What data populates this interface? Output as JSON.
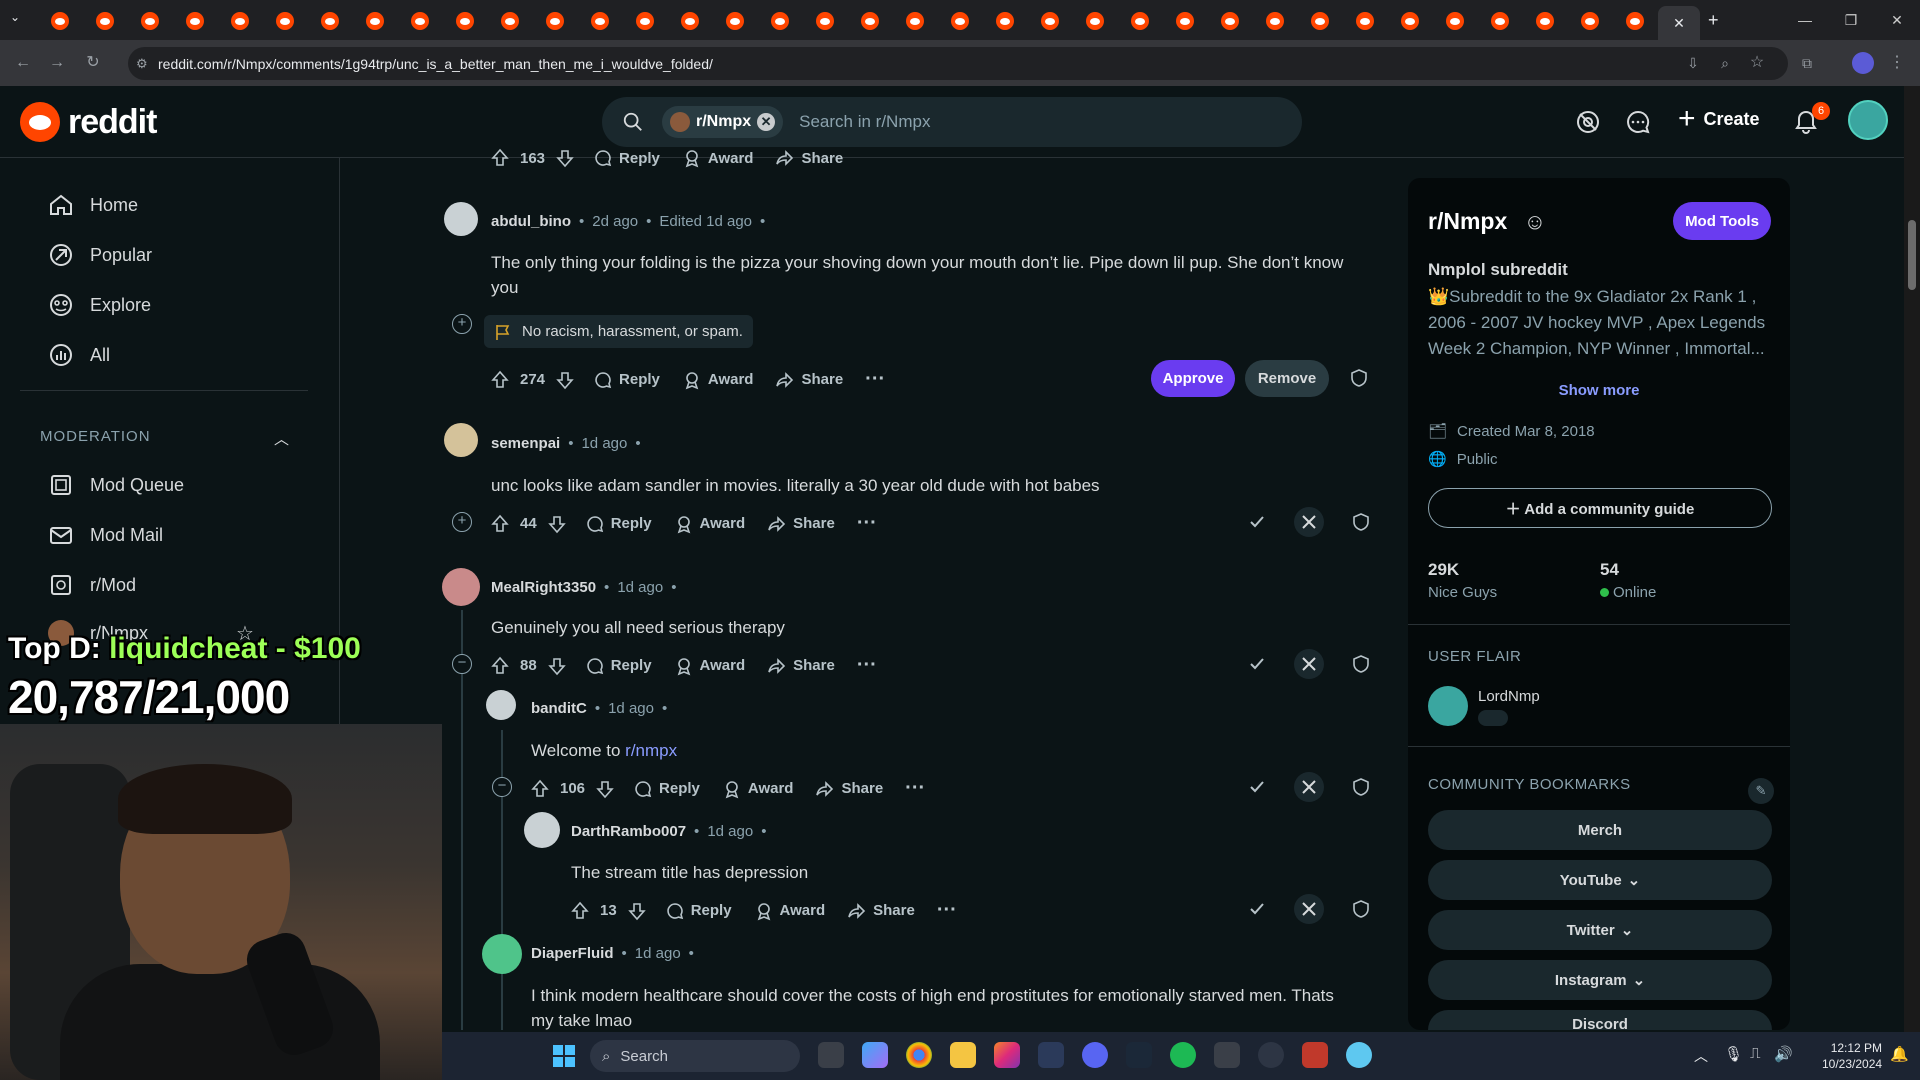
{
  "browser": {
    "url": "reddit.com/r/Nmpx/comments/1g94trp/unc_is_a_better_man_then_me_i_wouldve_folded/"
  },
  "header": {
    "logo_text": "reddit",
    "search_chip": "r/Nmpx",
    "search_placeholder": "Search in r/Nmpx",
    "create_label": "Create",
    "notification_count": "6"
  },
  "sidebar": {
    "items": [
      {
        "label": "Home",
        "icon": "home-icon"
      },
      {
        "label": "Popular",
        "icon": "popular-icon"
      },
      {
        "label": "Explore",
        "icon": "explore-icon"
      },
      {
        "label": "All",
        "icon": "all-icon"
      }
    ],
    "moderation_header": "MODERATION",
    "mod_items": [
      {
        "label": "Mod Queue",
        "icon": "mod-queue-icon"
      },
      {
        "label": "Mod Mail",
        "icon": "mod-mail-icon"
      },
      {
        "label": "r/Mod",
        "icon": "mod-icon"
      },
      {
        "label": "r/Nmpx",
        "icon": "subreddit-icon"
      }
    ]
  },
  "overlay": {
    "top_prefix": "Top D: ",
    "top_donor": "liquidcheat - $100",
    "counter": "20,787/21,000"
  },
  "comments": {
    "prev_actions": {
      "votes": "163",
      "reply": "Reply",
      "award": "Award",
      "share": "Share"
    },
    "c1": {
      "user": "abdul_bino",
      "time": "2d ago",
      "edited": "Edited 1d ago",
      "body": "The only thing your folding is the pizza your shoving down your mouth don’t lie. Pipe down lil pup. She don’t know you",
      "flag": "No racism, harassment, or spam.",
      "votes": "274",
      "reply": "Reply",
      "award": "Award",
      "share": "Share",
      "approve": "Approve",
      "remove": "Remove"
    },
    "c2": {
      "user": "semenpai",
      "time": "1d ago",
      "body": "unc looks like adam sandler in movies. literally a 30 year old dude with hot babes",
      "votes": "44",
      "reply": "Reply",
      "award": "Award",
      "share": "Share"
    },
    "c3": {
      "user": "MealRight3350",
      "time": "1d ago",
      "body": "Genuinely you all need serious therapy",
      "votes": "88",
      "reply": "Reply",
      "award": "Award",
      "share": "Share"
    },
    "c4": {
      "user": "banditC",
      "time": "1d ago",
      "body_prefix": "Welcome to ",
      "body_link": "r/nmpx",
      "votes": "106",
      "reply": "Reply",
      "award": "Award",
      "share": "Share"
    },
    "c5": {
      "user": "DarthRambo007",
      "time": "1d ago",
      "body": "The stream title has depression",
      "votes": "13",
      "reply": "Reply",
      "award": "Award",
      "share": "Share"
    },
    "c6": {
      "user": "DiaperFluid",
      "time": "1d ago",
      "body_l1": "I think modern healthcare should cover the costs of high end prostitutes for emotionally starved men. Thats",
      "body_l2": "my take lmao"
    }
  },
  "community": {
    "name": "r/Nmpx",
    "mod_tools": "Mod Tools",
    "title": "Nmplol subreddit",
    "description": "👑Subreddit to the 9x Gladiator 2x Rank 1 , 2006 - 2007 JV hockey MVP , Apex Legends Week 2 Champion, NYP Winner , Immortal...",
    "show_more": "Show more",
    "created": "Created Mar 8, 2018",
    "visibility": "Public",
    "guide_button": "Add a community guide",
    "members": "29K",
    "members_label": "Nice Guys",
    "online": "54",
    "online_label": "Online",
    "user_flair_header": "USER FLAIR",
    "flair_user": "LordNmp",
    "bookmarks_header": "COMMUNITY BOOKMARKS",
    "bookmarks": [
      "Merch",
      "YouTube",
      "Twitter",
      "Instagram",
      "Discord"
    ]
  },
  "taskbar": {
    "search": "Search",
    "time": "12:12 PM",
    "date": "10/23/2024"
  },
  "colors": {
    "background": "#0b1416",
    "accent_purple": "#6a3cf0",
    "reddit_orange": "#ff4500",
    "link": "#8a9cff",
    "online_green": "#2fbf4b"
  }
}
